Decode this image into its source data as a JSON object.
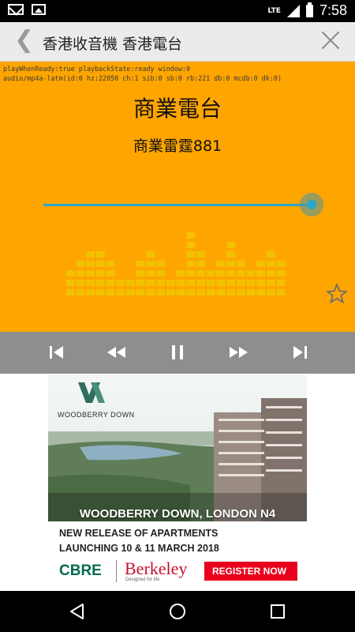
{
  "status_bar": {
    "time": "7:58",
    "network": "LTE",
    "icons": [
      "mail-icon",
      "image-icon",
      "signal-icon",
      "battery-icon"
    ]
  },
  "toolbar": {
    "back_glyph": "❮",
    "title": "香港收音機 香港電台",
    "icons": [
      "back-icon",
      "close-icon"
    ]
  },
  "player": {
    "debug_line1": "playWhenReady:true playbackState:ready window:0",
    "debug_line2": "audio/mp4a-latm(id:0 hz:22050 ch:1 sib:0 sb:0 rb:221 db:0 mcdb:0 dk:0)",
    "station_name": "商業電台",
    "channel_name": "商業雷霆881",
    "seek_progress": 1.0,
    "side_icons": [
      "star-icon",
      "copy-icon"
    ],
    "background_color": "#ffa500",
    "accent_color": "#2aa6c9"
  },
  "controls": {
    "buttons": [
      "skip-previous-icon",
      "rewind-icon",
      "pause-icon",
      "fast-forward-icon",
      "skip-next-icon"
    ]
  },
  "ad": {
    "logo_text": "WOODBERRY DOWN",
    "headline": "WOODBERRY DOWN, LONDON N4",
    "line1": "NEW RELEASE OF APARTMENTS",
    "line2": "LAUNCHING 10 & 11 MARCH 2018",
    "brand1": "CBRE",
    "brand2": "Berkeley",
    "brand2_tagline": "Designed for life",
    "cta": "REGISTER NOW",
    "cta_color": "#e8001c",
    "brand1_color": "#006a4d"
  },
  "nav_bar": {
    "buttons": [
      "back-triangle-icon",
      "home-circle-icon",
      "recents-square-icon"
    ]
  }
}
